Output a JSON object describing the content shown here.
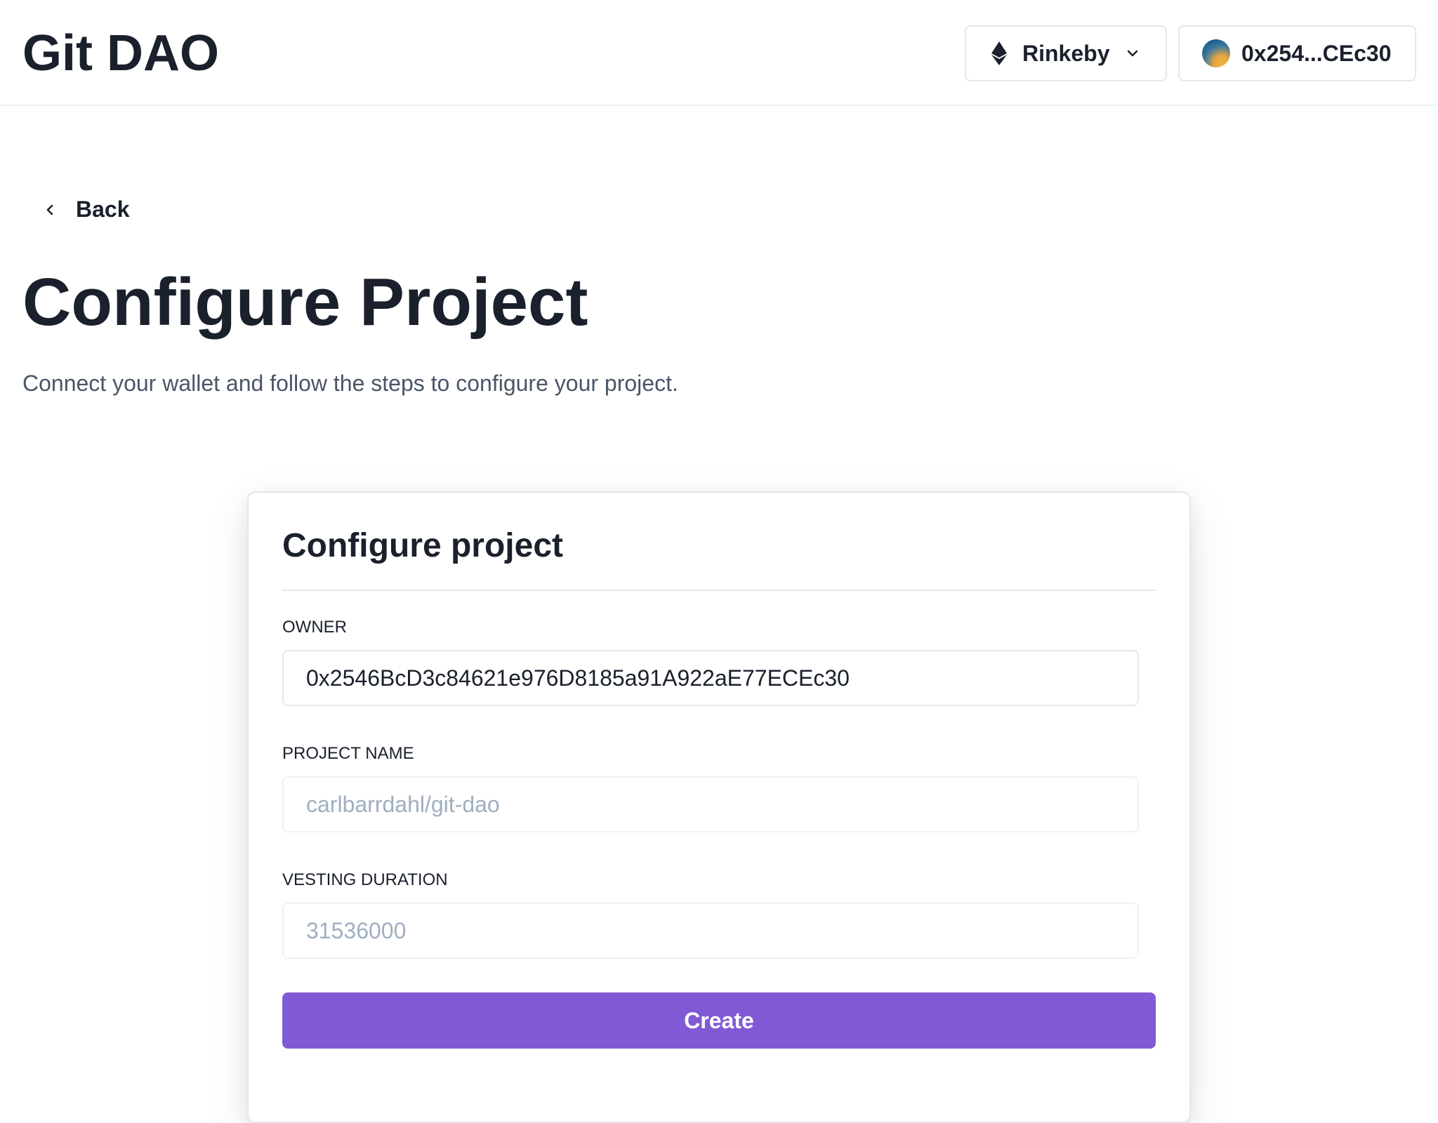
{
  "header": {
    "brand": "Git DAO",
    "network": {
      "label": "Rinkeby",
      "icon": "ethereum-icon",
      "dropdown_icon": "chevron-down-icon"
    },
    "account": {
      "address_short": "0x254...CEc30",
      "avatar": "jazzicon-avatar"
    }
  },
  "nav": {
    "back_label": "Back",
    "back_icon": "chevron-left-icon"
  },
  "page": {
    "title": "Configure Project",
    "subtitle": "Connect your wallet and follow the steps to configure your project."
  },
  "form": {
    "title": "Configure project",
    "owner": {
      "label": "OWNER",
      "value": "0x2546BcD3c84621e976D8185a91A922aE77ECEc30"
    },
    "project_name": {
      "label": "PROJECT NAME",
      "placeholder": "carlbarrdahl/git-dao"
    },
    "vesting_duration": {
      "label": "VESTING DURATION",
      "placeholder": "31536000"
    },
    "submit_label": "Create"
  },
  "colors": {
    "primary": "#805ad5",
    "text": "#1a202c",
    "muted": "#4a5568",
    "border": "#e2e8f0",
    "placeholder": "#a0aec0"
  }
}
